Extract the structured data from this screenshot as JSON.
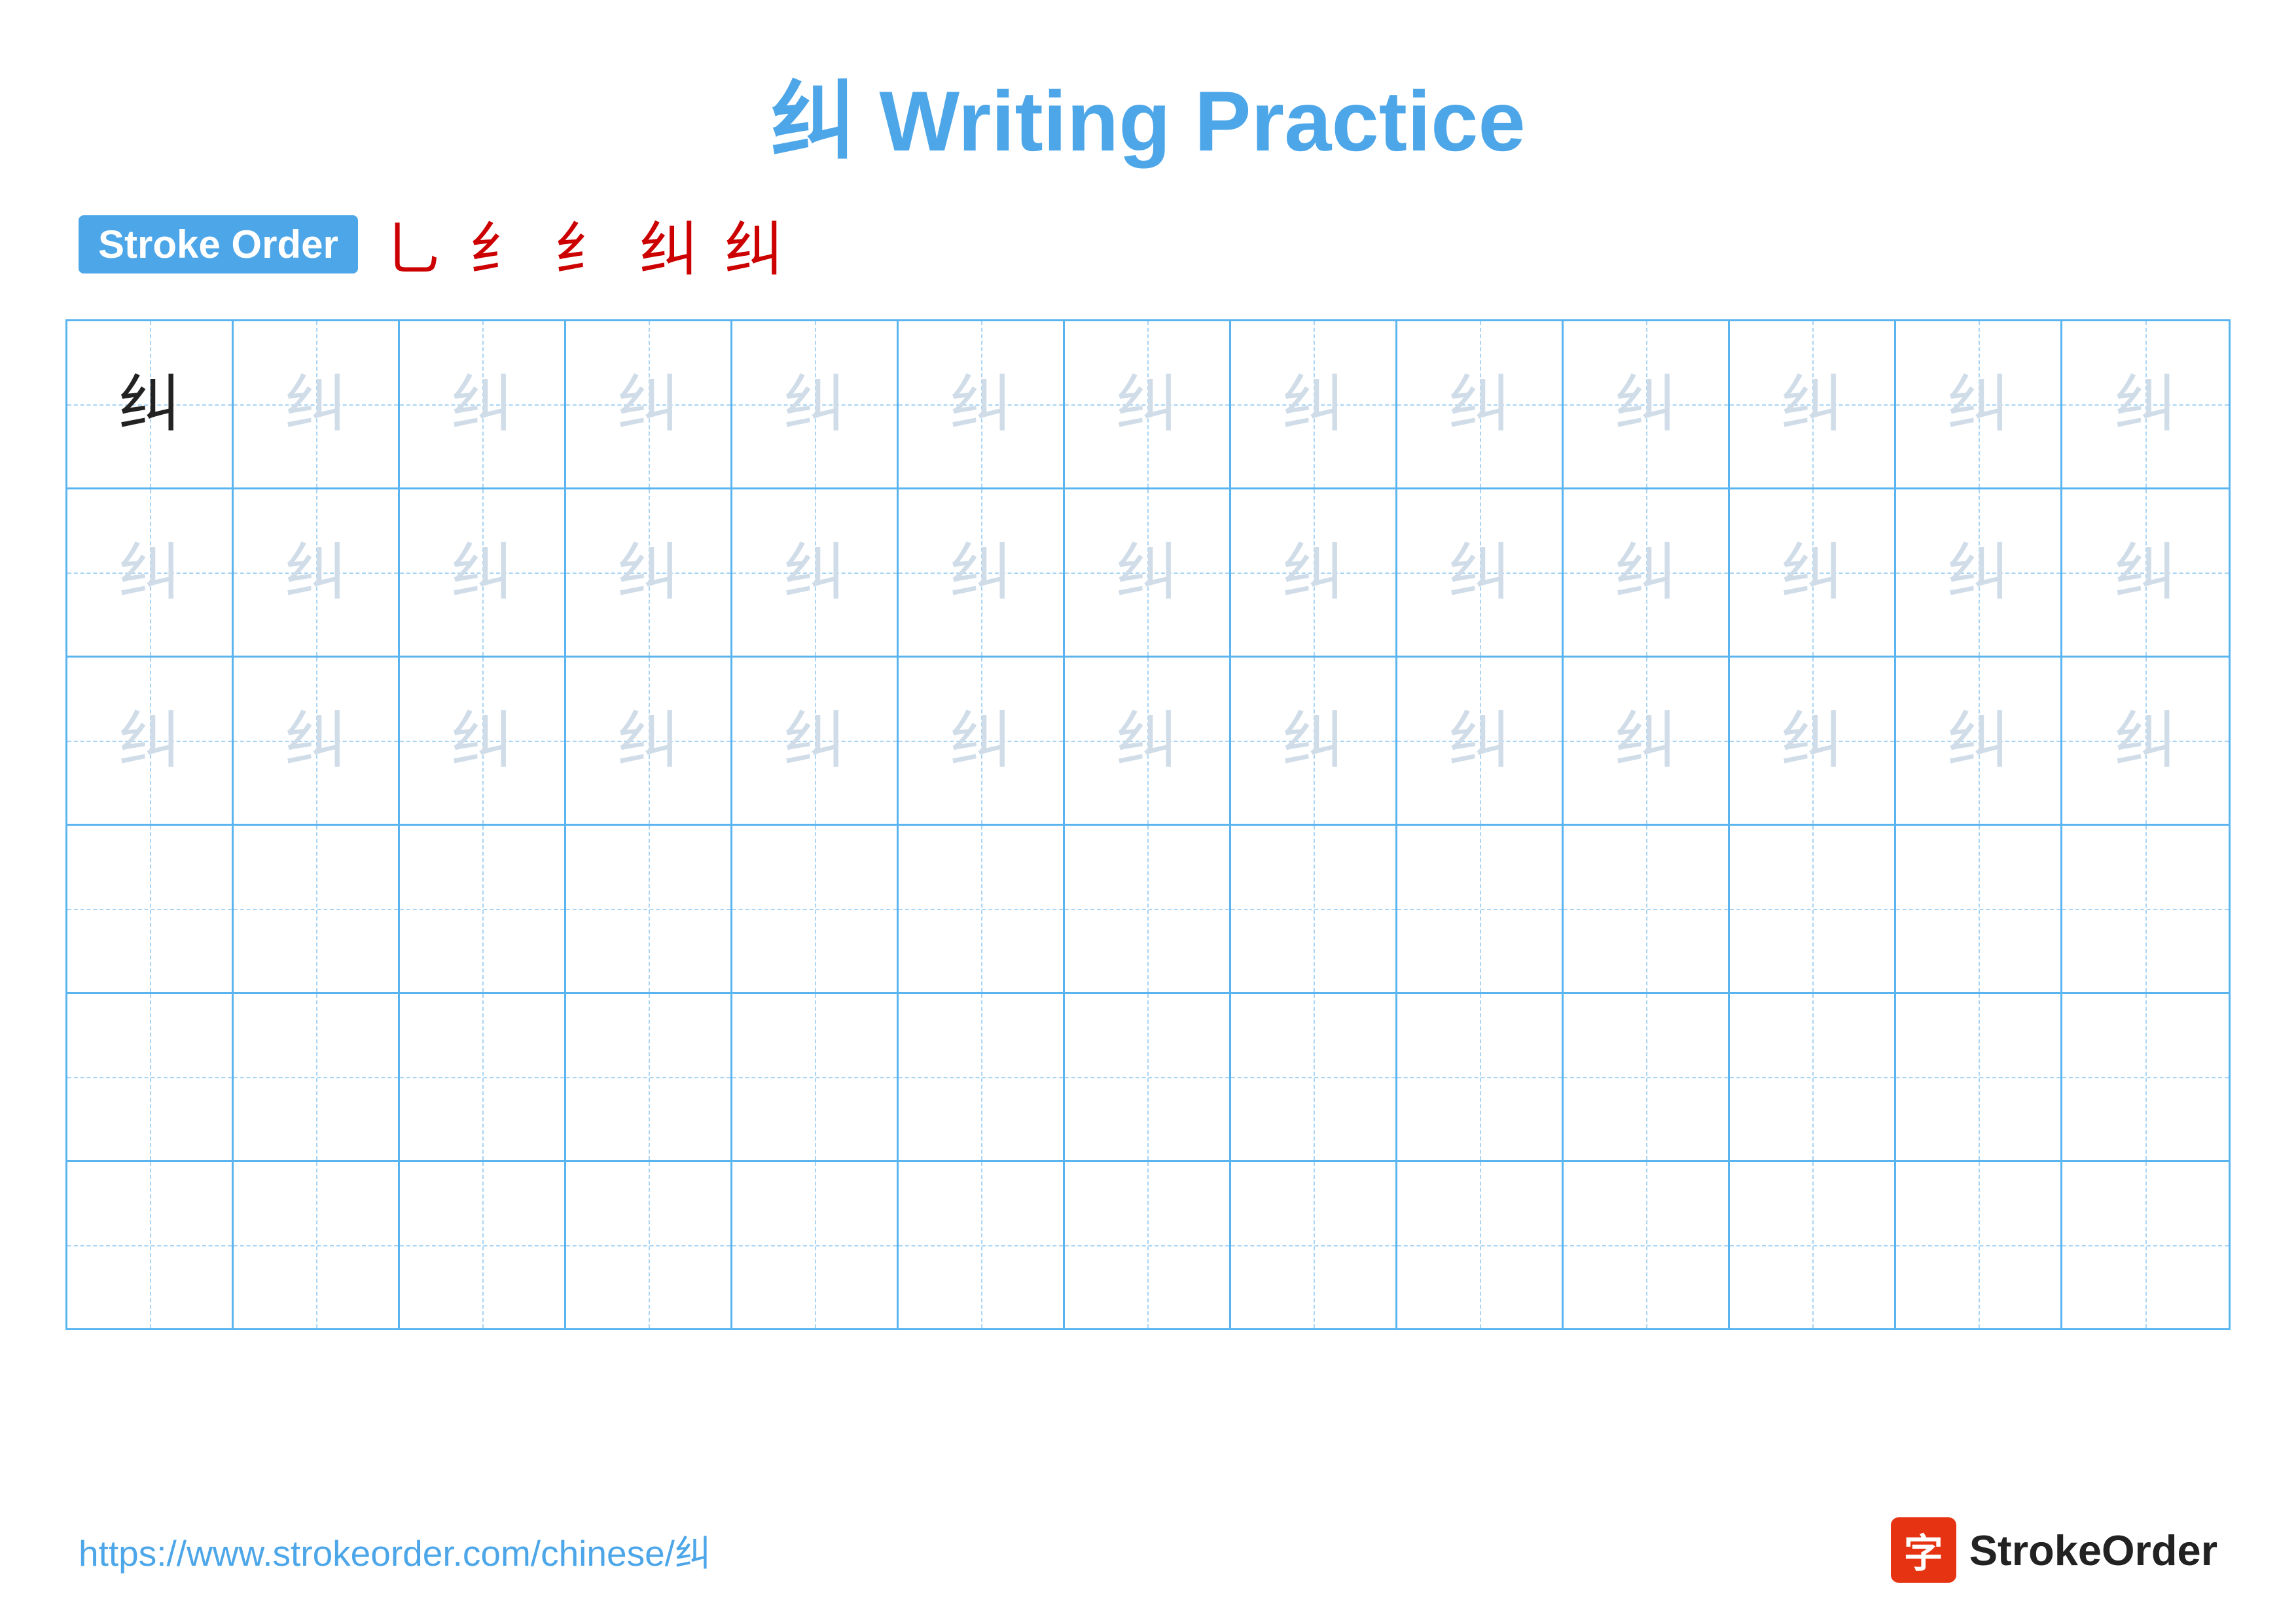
{
  "page": {
    "title": "纠 Writing Practice",
    "character": "纠",
    "title_color": "#4da6e8"
  },
  "stroke_order": {
    "badge_label": "Stroke Order",
    "steps": [
      "乚",
      "纠̀",
      "纠̄",
      "纠̃",
      "纠"
    ]
  },
  "grid": {
    "rows": 6,
    "cols": 13,
    "char": "纠",
    "row_types": [
      "dark_then_light",
      "light",
      "light",
      "empty",
      "empty",
      "empty"
    ]
  },
  "footer": {
    "url": "https://www.strokeorder.com/chinese/纠",
    "logo_char": "字",
    "logo_name": "StrokeOrder"
  }
}
